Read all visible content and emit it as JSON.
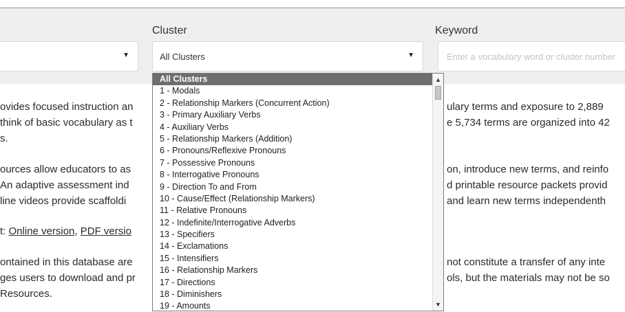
{
  "filters": {
    "first_select_value": "",
    "cluster_label": "Cluster",
    "cluster_value": "All Clusters",
    "keyword_label": "Keyword",
    "keyword_placeholder": "Enter a vocabulary word or cluster number"
  },
  "body_lines": [
    "ovides focused instruction an",
    "think of basic vocabulary as t",
    "s.",
    "ources allow educators to as",
    " An adaptive assessment ind",
    "line videos provide scaffoldi",
    "ontained in this database are",
    "ges users to download and pr",
    "Resources."
  ],
  "body_right_lines": [
    "ulary terms and exposure to 2,889",
    "e 5,734 terms are organized into 42",
    "on, introduce new terms, and reinfo",
    "d printable resource packets provid",
    " and learn new terms independenth",
    "not constitute a transfer of any inte",
    "ols, but the materials may not be so"
  ],
  "links_line": {
    "prefix": "t: ",
    "online_link": "Online version",
    "separator": ", ",
    "pdf_link": "PDF versio"
  },
  "dropdown": {
    "options": [
      "All Clusters",
      "1 - Modals",
      "2 - Relationship Markers (Concurrent Action)",
      "3 - Primary Auxiliary Verbs",
      "4 - Auxiliary Verbs",
      "5 - Relationship Markers (Addition)",
      "6 - Pronouns/Reflexive Pronouns",
      "7 - Possessive Pronouns",
      "8 - Interrogative Pronouns",
      "9 - Direction To and From",
      "10 - Cause/Effect (Relationship Markers)",
      "11 - Relative Pronouns",
      "12 - Indefinite/Interrogative Adverbs",
      "13 - Specifiers",
      "14 - Exclamations",
      "15 - Intensifiers",
      "16 - Relationship Markers",
      "17 - Directions",
      "18 - Diminishers",
      "19 - Amounts"
    ],
    "selected_index": 0
  },
  "icons": {
    "select_arrow": "caret-down-icon",
    "scroll_up": "scroll-up-arrow-icon",
    "scroll_down": "scroll-down-arrow-icon"
  }
}
